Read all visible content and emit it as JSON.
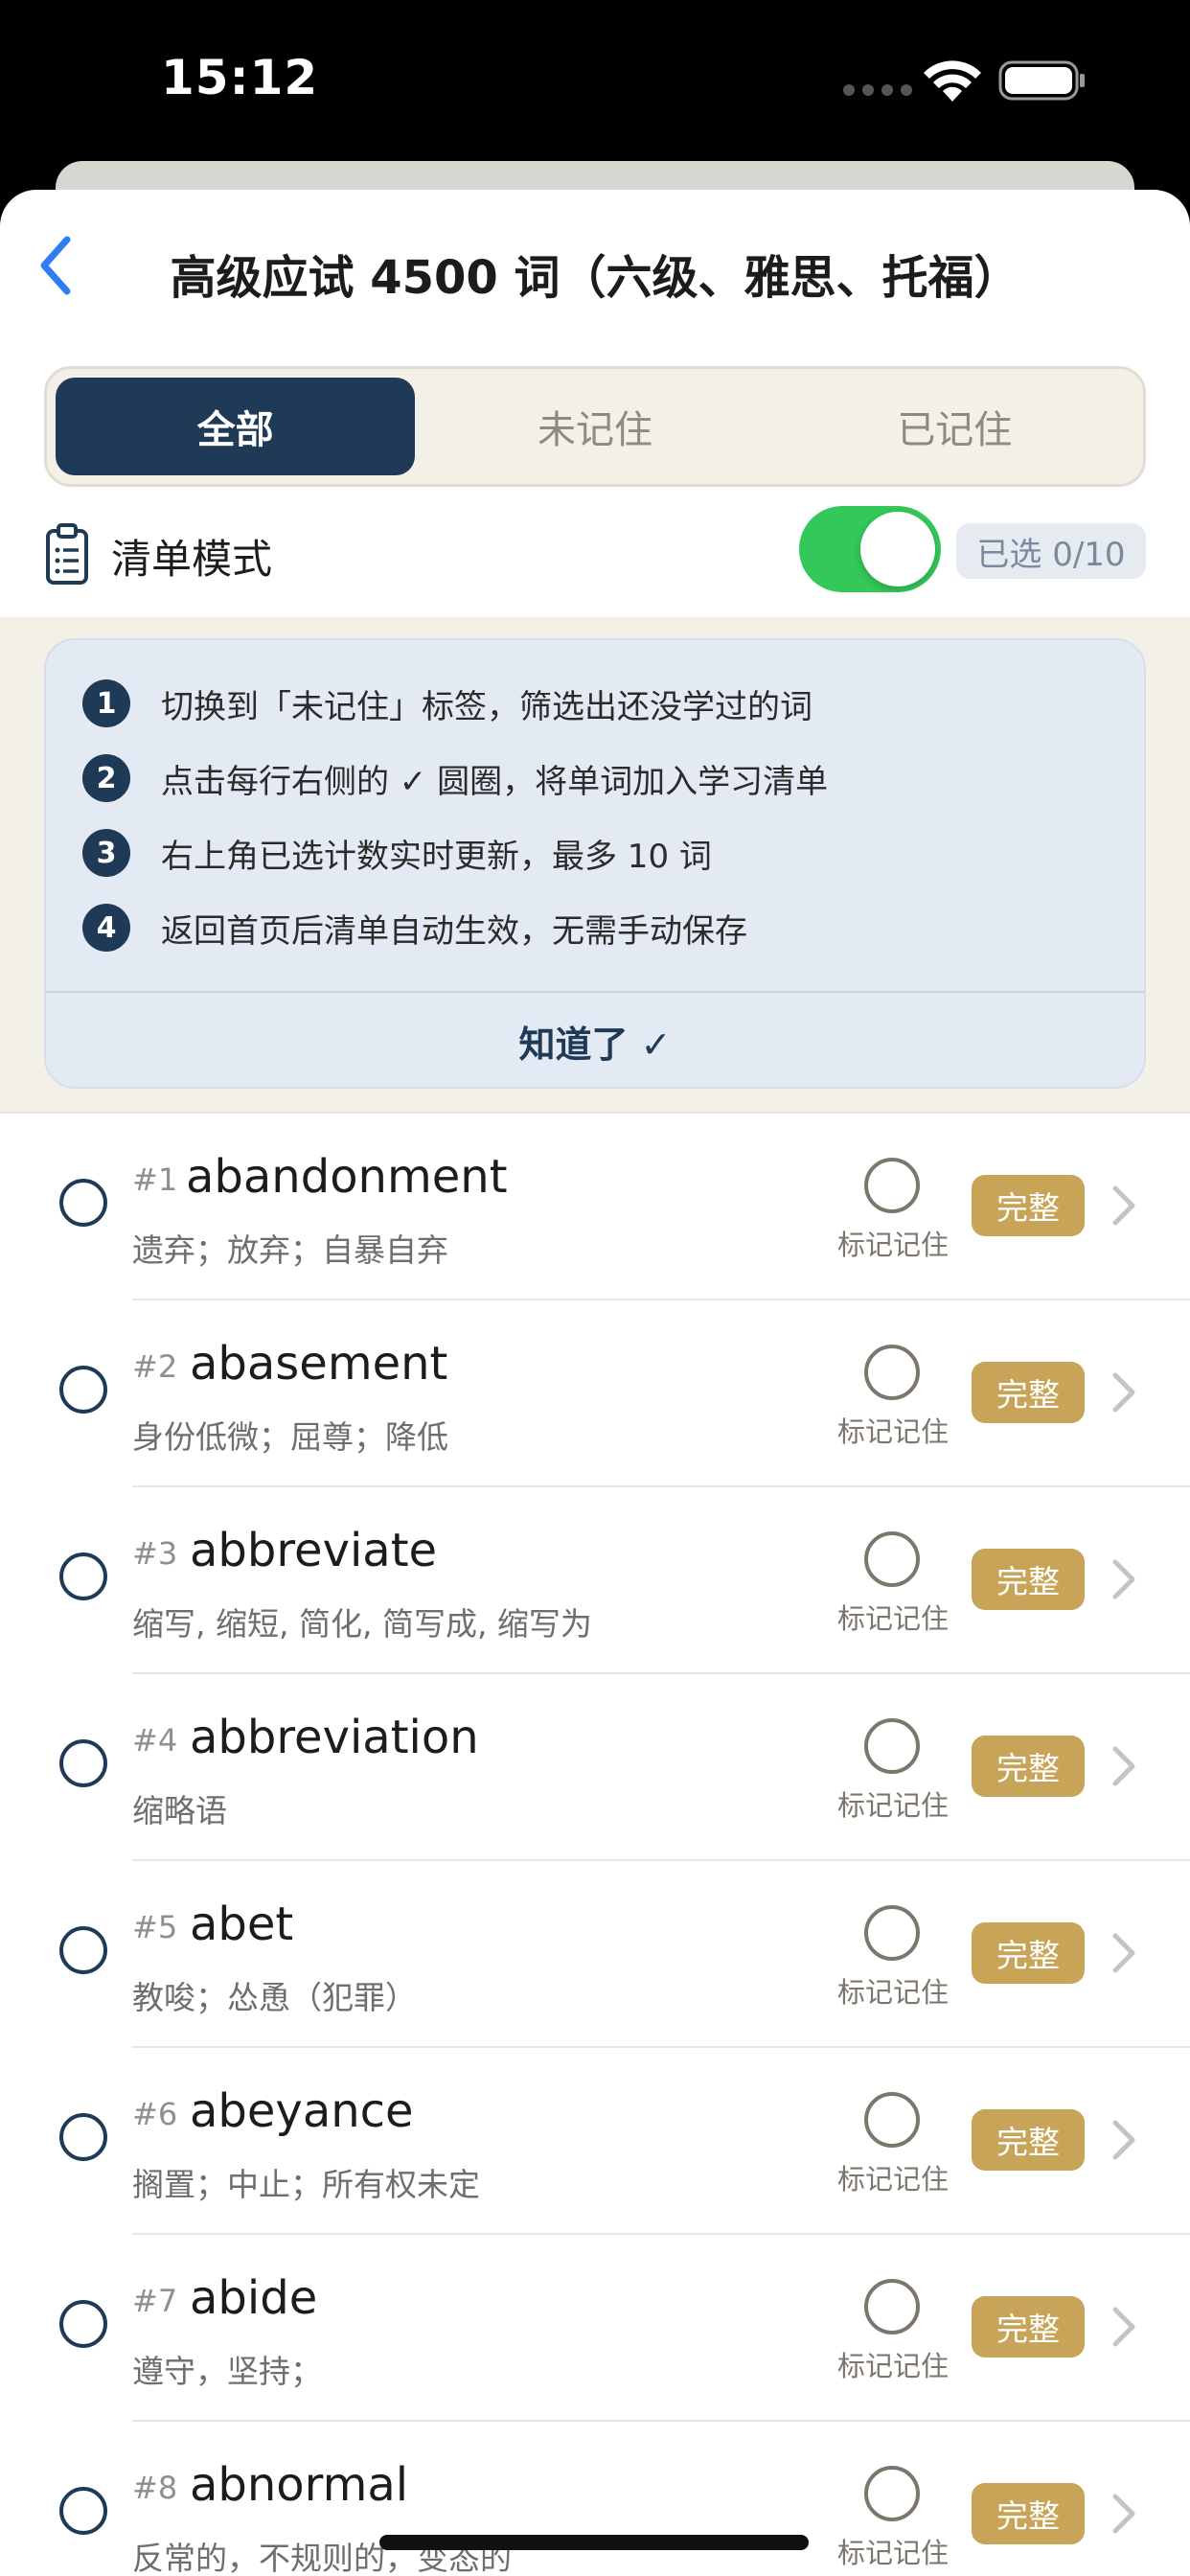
{
  "status_bar": {
    "time": "15:12"
  },
  "nav": {
    "title": "高级应试 4500 词（六级、雅思、托福）"
  },
  "segments": [
    {
      "label": "全部",
      "active": true
    },
    {
      "label": "未记住",
      "active": false
    },
    {
      "label": "已记住",
      "active": false
    }
  ],
  "list_mode": {
    "label": "清单模式",
    "enabled": true,
    "selected_count": "已选 0/10"
  },
  "tips": {
    "items": [
      {
        "num": "1",
        "text": "切换到「未记住」标签，筛选出还没学过的词"
      },
      {
        "num": "2",
        "text": "点击每行右侧的 ✓ 圆圈，将单词加入学习清单"
      },
      {
        "num": "3",
        "text": "右上角已选计数实时更新，最多 10 词"
      },
      {
        "num": "4",
        "text": "返回首页后清单自动生效，无需手动保存"
      }
    ],
    "dismiss_label": "知道了 ✓"
  },
  "words": [
    {
      "index": "#1",
      "word": "abandonment",
      "meaning": "遗弃；放弃；自暴自弃",
      "memorize_label": "标记记住",
      "badge": "完整"
    },
    {
      "index": "#2",
      "word": "abasement",
      "meaning": "身份低微；屈尊；降低",
      "memorize_label": "标记记住",
      "badge": "完整"
    },
    {
      "index": "#3",
      "word": "abbreviate",
      "meaning": "缩写, 缩短, 简化, 简写成, 缩写为",
      "memorize_label": "标记记住",
      "badge": "完整"
    },
    {
      "index": "#4",
      "word": "abbreviation",
      "meaning": "缩略语",
      "memorize_label": "标记记住",
      "badge": "完整"
    },
    {
      "index": "#5",
      "word": "abet",
      "meaning": "教唆；怂恿（犯罪）",
      "memorize_label": "标记记住",
      "badge": "完整"
    },
    {
      "index": "#6",
      "word": "abeyance",
      "meaning": "搁置；中止；所有权未定",
      "memorize_label": "标记记住",
      "badge": "完整"
    },
    {
      "index": "#7",
      "word": "abide",
      "meaning": "遵守，坚持；",
      "memorize_label": "标记记住",
      "badge": "完整"
    },
    {
      "index": "#8",
      "word": "abnormal",
      "meaning": "反常的，不规则的，变态的",
      "memorize_label": "标记记住",
      "badge": "完整"
    }
  ],
  "colors": {
    "primary": "#1e3a56",
    "accent_gold": "#c8a458",
    "toggle_on": "#34c759",
    "cream": "#f3f0e8"
  }
}
